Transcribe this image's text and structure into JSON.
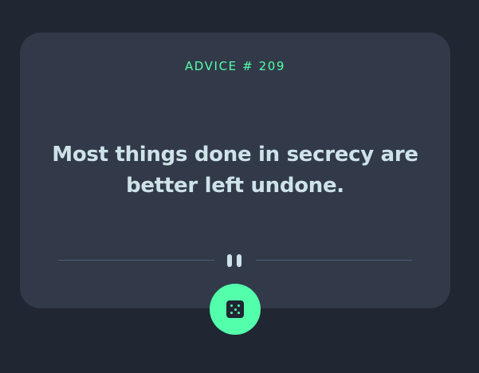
{
  "advice": {
    "id_label": "ADVICE # 209",
    "quote": "Most things done in secrecy are better left undone."
  },
  "colors": {
    "background": "#202632",
    "card": "#323a4a",
    "accent": "#53ffaa",
    "text": "#cee3e9",
    "divider": "#4f5d74"
  },
  "icons": {
    "divider": "pause-icon",
    "button": "dice-icon"
  }
}
